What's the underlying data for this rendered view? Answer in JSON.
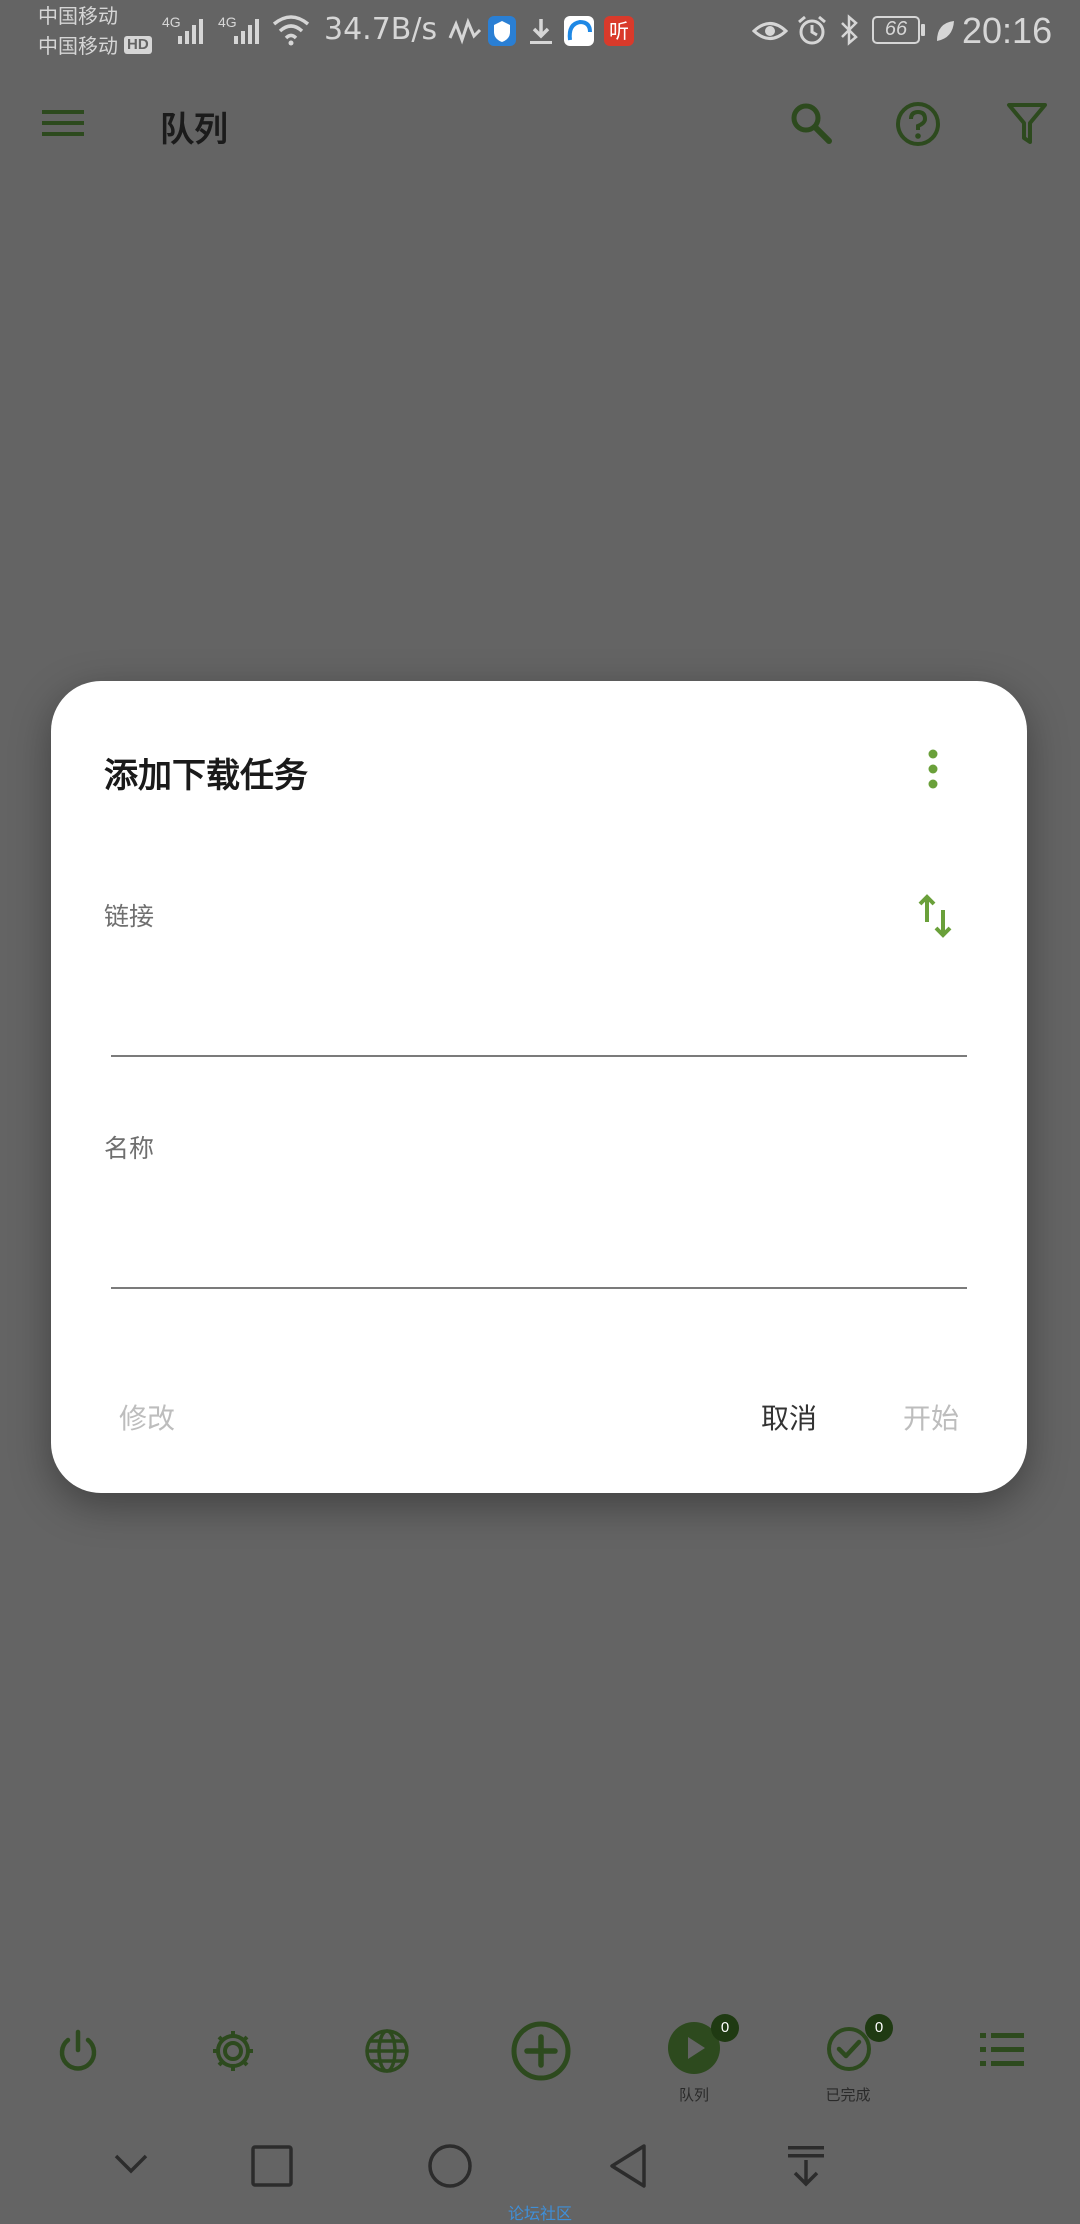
{
  "status_bar": {
    "carrier_1": "中国移动",
    "carrier_2": "中国移动",
    "hd": "HD",
    "signal_1": "4G",
    "signal_2": "4G",
    "net_speed": "34.7B/s",
    "battery": "66",
    "time": "20:16",
    "app_icon_listen": "听"
  },
  "toolbar": {
    "title": "队列",
    "icons": [
      "menu-icon",
      "search-icon",
      "help-icon",
      "filter-icon"
    ]
  },
  "dialog": {
    "title": "添加下载任务",
    "link_label": "链接",
    "link_value": "",
    "name_label": "名称",
    "name_value": "",
    "modify_button": "修改",
    "cancel_button": "取消",
    "start_button": "开始"
  },
  "bottom_nav": {
    "items": [
      {
        "icon": "power-icon"
      },
      {
        "icon": "settings-icon"
      },
      {
        "icon": "globe-icon"
      },
      {
        "icon": "add-icon"
      },
      {
        "icon": "play-icon",
        "label": "队列",
        "badge": "0"
      },
      {
        "icon": "check-icon",
        "label": "已完成",
        "badge": "0"
      },
      {
        "icon": "list-icon"
      }
    ]
  },
  "system_nav": {
    "footer_text": "论坛社区"
  },
  "colors": {
    "accent": "#6aa03a",
    "dim_accent": "#2d4a1e",
    "scrim": "#646464"
  }
}
